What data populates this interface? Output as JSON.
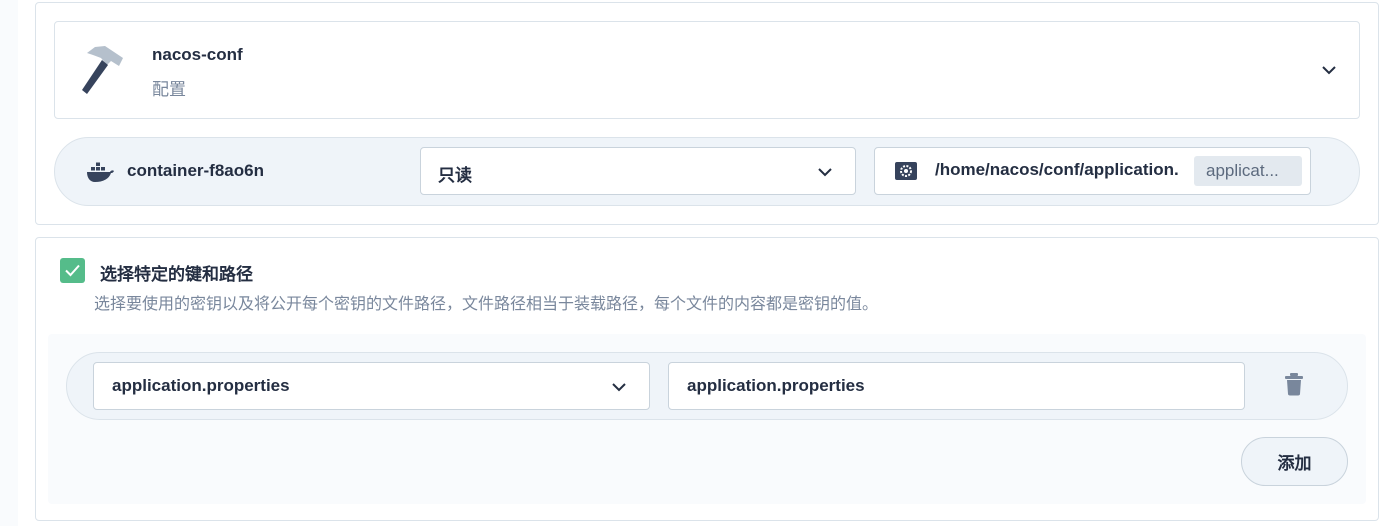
{
  "volume": {
    "name": "nacos-conf",
    "type_label": "配置",
    "icon": "hammer-icon"
  },
  "mount": {
    "container": "container-f8ao6n",
    "container_icon": "docker-icon",
    "access_mode": "只读",
    "mount_path": "/home/nacos/conf/application.",
    "sub_path": "applicat...",
    "path_icon": "gear-icon"
  },
  "specific_keys": {
    "checked": true,
    "title": "选择特定的键和路径",
    "description": "选择要使用的密钥以及将公开每个密钥的文件路径，文件路径相当于装载路径，每个文件的内容都是密钥的值。",
    "items": [
      {
        "key": "application.properties",
        "path": "application.properties"
      }
    ],
    "add_label": "添加"
  },
  "colors": {
    "accent_green": "#55bc8a",
    "text_primary": "#242e42",
    "text_secondary": "#79879c",
    "row_bg": "#eff4f9",
    "border": "#dbe3ea"
  }
}
